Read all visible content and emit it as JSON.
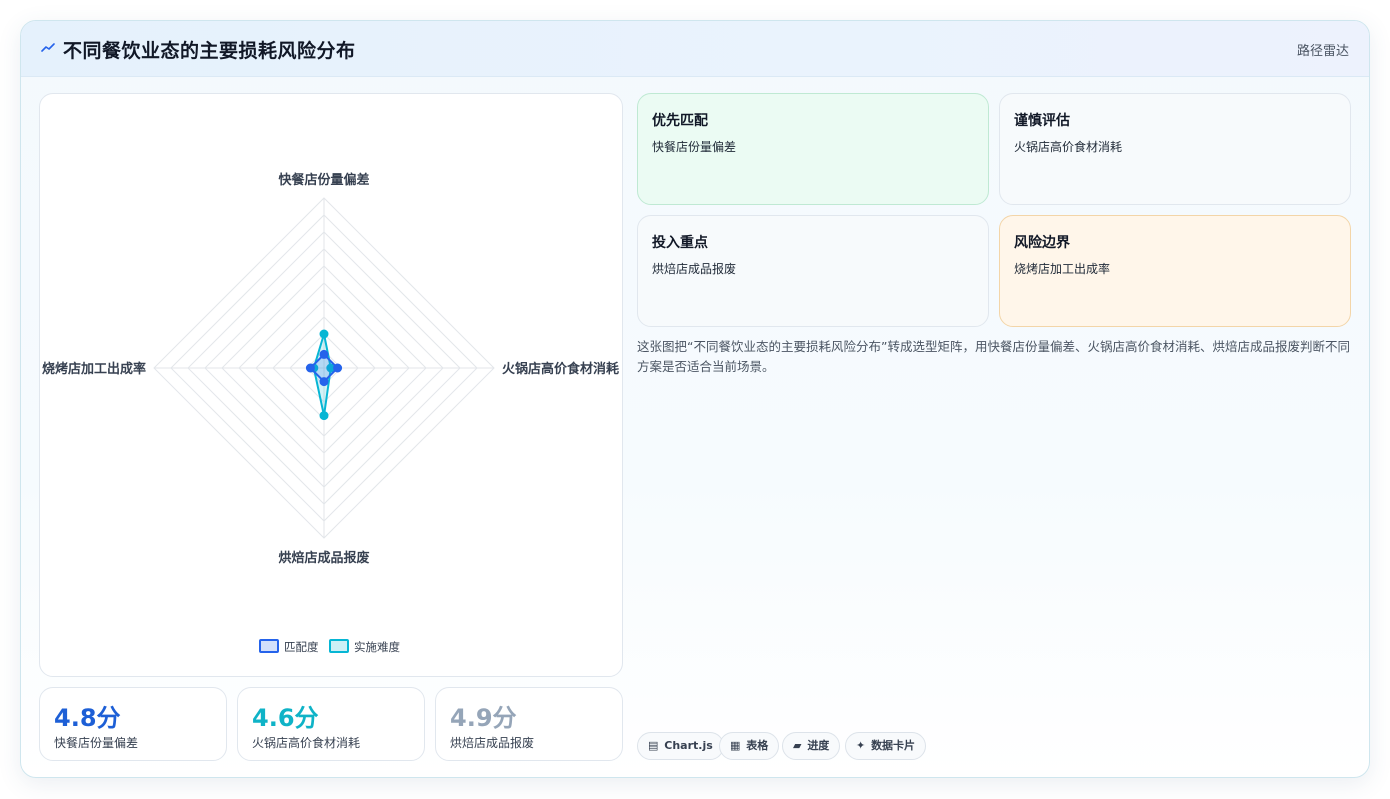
{
  "header": {
    "title": "不同餐饮业态的主要损耗风险分布",
    "link": "路径雷达"
  },
  "chart_data": {
    "type": "radar",
    "axes": [
      "快餐店份量偏差",
      "火锅店高价食材消耗",
      "烘焙店成品报废",
      "烧烤店加工出成率"
    ],
    "series": [
      {
        "name": "匹配度",
        "values": [
          0.4,
          0.4,
          0.4,
          0.4
        ],
        "color": "#2563eb"
      },
      {
        "name": "实施难度",
        "values": [
          1.0,
          0.2,
          1.4,
          0.3
        ],
        "color": "#06b6d4"
      }
    ],
    "rmax": 5,
    "rings": 10,
    "legend_position": "bottom",
    "legend": [
      "匹配度",
      "实施难度"
    ]
  },
  "stats": [
    {
      "value": "4.8分",
      "label": "快餐店份量偏差",
      "color": "#1d5fd6"
    },
    {
      "value": "4.6分",
      "label": "火锅店高价食材消耗",
      "color": "#0fb3c7"
    },
    {
      "value": "4.9分",
      "label": "烘焙店成品报废",
      "color": "#95a5b8"
    }
  ],
  "cards": [
    {
      "title": "优先匹配",
      "text": "快餐店份量偏差"
    },
    {
      "title": "谨慎评估",
      "text": "火锅店高价食材消耗"
    },
    {
      "title": "投入重点",
      "text": "烘焙店成品报废"
    },
    {
      "title": "风险边界",
      "text": "烧烤店加工出成率"
    }
  ],
  "description": "这张图把“不同餐饮业态的主要损耗风险分布”转成选型矩阵，用快餐店份量偏差、火锅店高价食材消耗、烘焙店成品报废判断不同方案是否适合当前场景。",
  "tags": [
    {
      "icon": "▤",
      "label": "Chart.js"
    },
    {
      "icon": "▦",
      "label": "表格"
    },
    {
      "icon": "▰",
      "label": "进度"
    },
    {
      "icon": "✦",
      "label": "数据卡片"
    }
  ]
}
